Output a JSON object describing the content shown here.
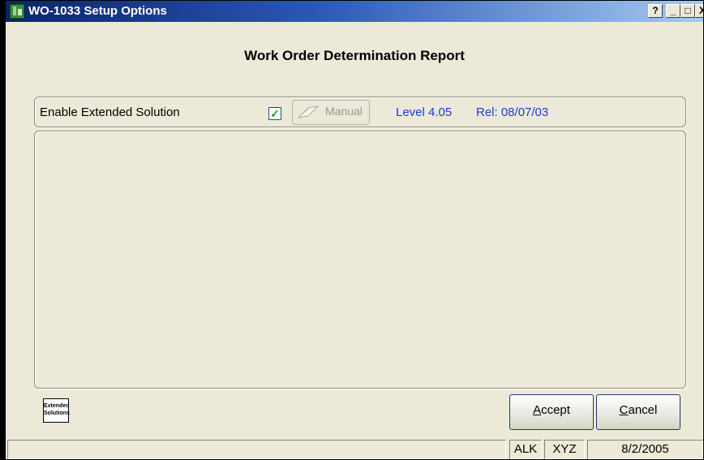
{
  "window": {
    "title": "WO-1033  Setup Options",
    "controls": {
      "help": "?",
      "minimize": "_",
      "maximize": "□",
      "close": "X"
    }
  },
  "report_title": "Work Order Determination Report",
  "options": {
    "enable_label": "Enable Extended Solution",
    "enable_checked": true,
    "checkbox_mark": "✓",
    "manual_label": "Manual",
    "level": "Level 4.05",
    "release": "Rel: 08/07/03",
    "accent_color": "#1b3cd6"
  },
  "logo": {
    "line1": "Extended",
    "line2": "Solutions"
  },
  "buttons": {
    "accept_underline": "A",
    "accept_rest": "ccept",
    "cancel_underline": "C",
    "cancel_rest": "ancel"
  },
  "statusbar": {
    "message": "",
    "user": "ALK",
    "company": "XYZ",
    "date": "8/2/2005"
  },
  "icons": [
    "app-icon",
    "help-icon",
    "minimize-icon",
    "maximize-icon",
    "close-icon",
    "manual-icon",
    "extended-solutions-logo"
  ]
}
